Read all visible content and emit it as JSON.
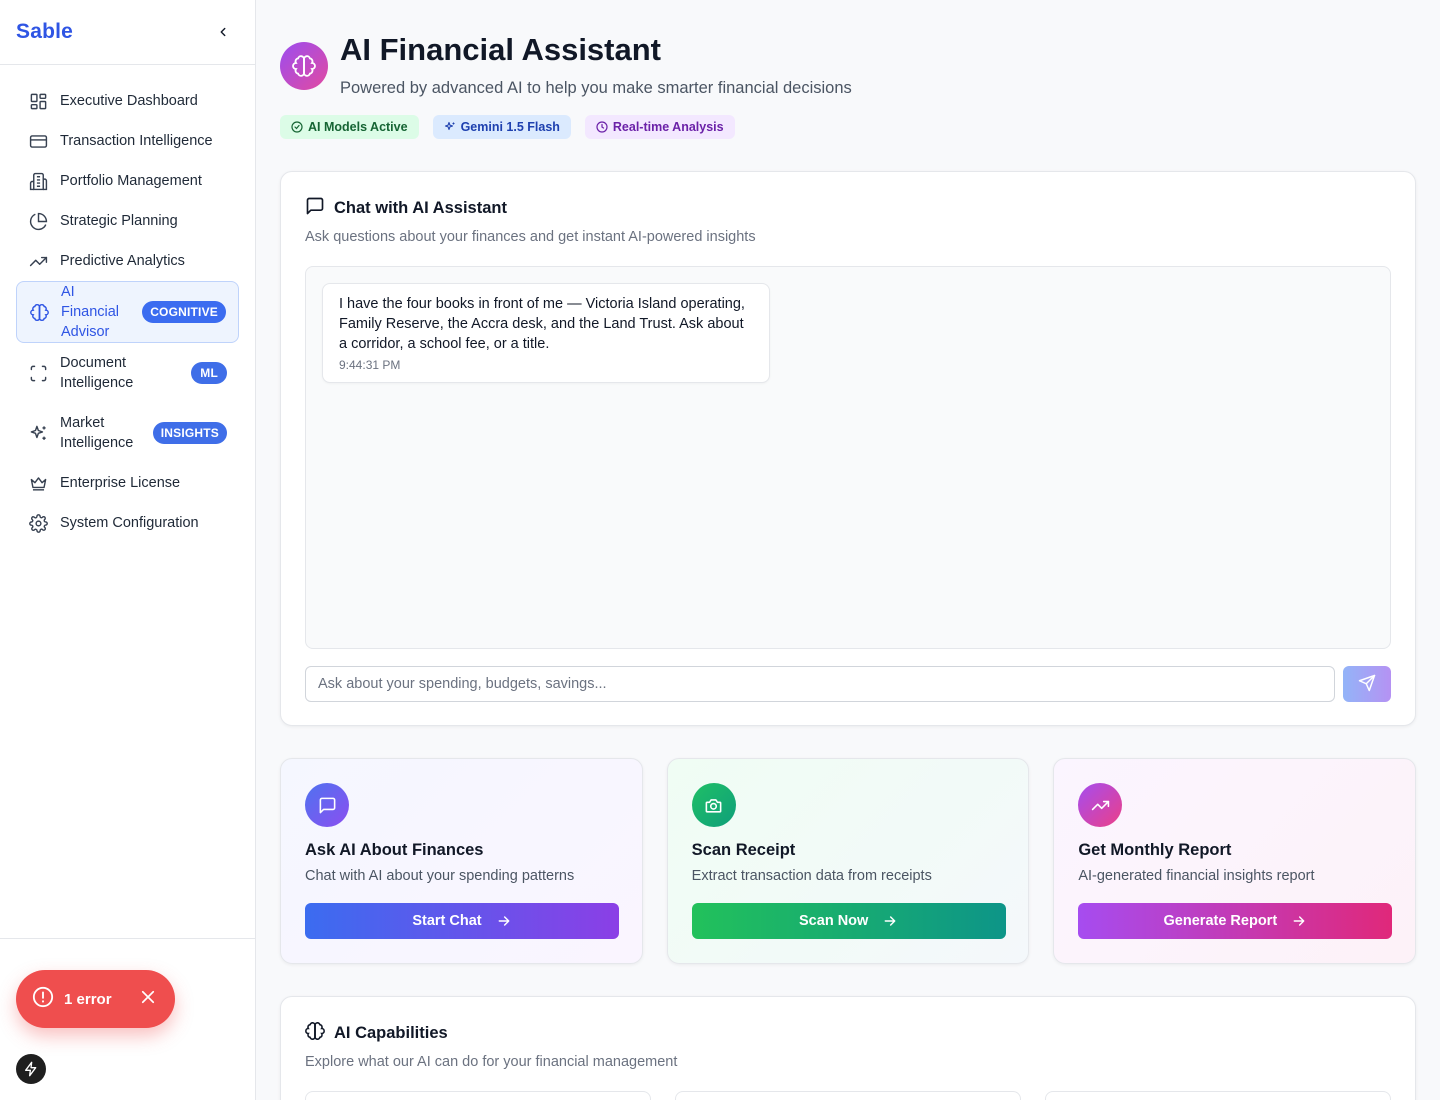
{
  "sidebar": {
    "brand": "Sable",
    "items": [
      {
        "label": "Executive Dashboard",
        "icon": "dashboard-icon"
      },
      {
        "label": "Transaction Intelligence",
        "icon": "credit-card-icon"
      },
      {
        "label": "Portfolio Management",
        "icon": "building-icon"
      },
      {
        "label": "Strategic Planning",
        "icon": "pie-chart-icon"
      },
      {
        "label": "Predictive Analytics",
        "icon": "trending-up-icon"
      },
      {
        "label": "AI Financial Advisor",
        "icon": "brain-icon",
        "badge": "COGNITIVE",
        "active": true
      },
      {
        "label": "Document Intelligence",
        "icon": "scan-icon",
        "badge": "ML"
      },
      {
        "label": "Market Intelligence",
        "icon": "sparkles-icon",
        "badge": "INSIGHTS"
      },
      {
        "label": "Enterprise License",
        "icon": "crown-icon"
      },
      {
        "label": "System Configuration",
        "icon": "gear-icon"
      }
    ]
  },
  "toast": {
    "label": "1 error"
  },
  "header": {
    "title": "AI Financial Assistant",
    "subtitle": "Powered by advanced AI to help you make smarter financial decisions",
    "pills": [
      "AI Models Active",
      "Gemini 1.5 Flash",
      "Real-time Analysis"
    ]
  },
  "chat": {
    "title": "Chat with AI Assistant",
    "description": "Ask questions about your finances and get instant AI-powered insights",
    "messages": [
      {
        "text": "I have the four books in front of me — Victoria Island operating, Family Reserve, the Accra desk, and the Land Trust. Ask about a corridor, a school fee, or a title.",
        "time": "9:44:31 PM"
      }
    ],
    "input_placeholder": "Ask about your spending, budgets, savings..."
  },
  "actions": [
    {
      "title": "Ask AI About Finances",
      "description": "Chat with AI about your spending patterns",
      "button": "Start Chat"
    },
    {
      "title": "Scan Receipt",
      "description": "Extract transaction data from receipts",
      "button": "Scan Now"
    },
    {
      "title": "Get Monthly Report",
      "description": "AI-generated financial insights report",
      "button": "Generate Report"
    }
  ],
  "capabilities": {
    "title": "AI Capabilities",
    "description": "Explore what our AI can do for your financial management"
  },
  "colors": {
    "brand": "#2f55e4",
    "error": "#ef4e4e",
    "active_bg": "#eef4fe"
  }
}
